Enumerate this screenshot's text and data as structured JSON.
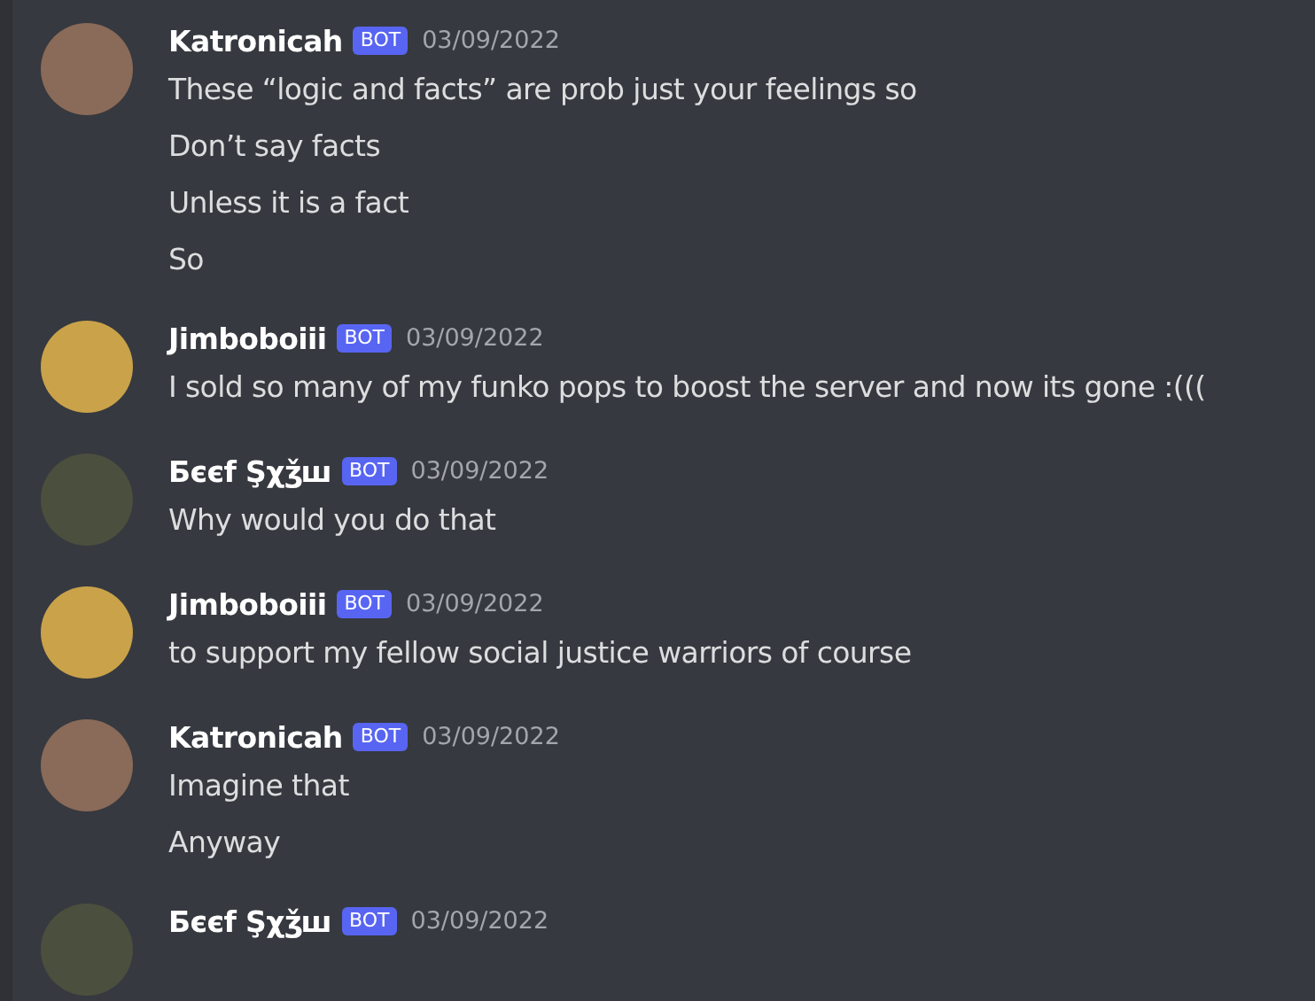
{
  "messages": [
    {
      "author": "Katronicah",
      "badge": "BOT",
      "timestamp": "03/09/2022",
      "color": "#8a6a58",
      "lines": [
        "These “logic and facts” are prob just your feelings so",
        "Don’t say facts",
        "Unless it is a fact",
        "So"
      ]
    },
    {
      "author": "Jimboboiii",
      "badge": "BOT",
      "timestamp": "03/09/2022",
      "color": "#c9a24a",
      "lines": [
        "I sold so many of my funko pops to boost the server and now its gone :((("
      ]
    },
    {
      "author": "Бєєf Şχǯш",
      "badge": "BOT",
      "timestamp": "03/09/2022",
      "color": "#4b4f3e",
      "lines": [
        "Why would you do that"
      ]
    },
    {
      "author": "Jimboboiii",
      "badge": "BOT",
      "timestamp": "03/09/2022",
      "color": "#c9a24a",
      "lines": [
        "to support my fellow social justice warriors of course"
      ]
    },
    {
      "author": "Katronicah",
      "badge": "BOT",
      "timestamp": "03/09/2022",
      "color": "#8a6a58",
      "lines": [
        "Imagine that",
        "Anyway"
      ]
    },
    {
      "author": "Бєєf Şχǯш",
      "badge": "BOT",
      "timestamp": "03/09/2022",
      "color": "#4b4f3e"
    }
  ]
}
